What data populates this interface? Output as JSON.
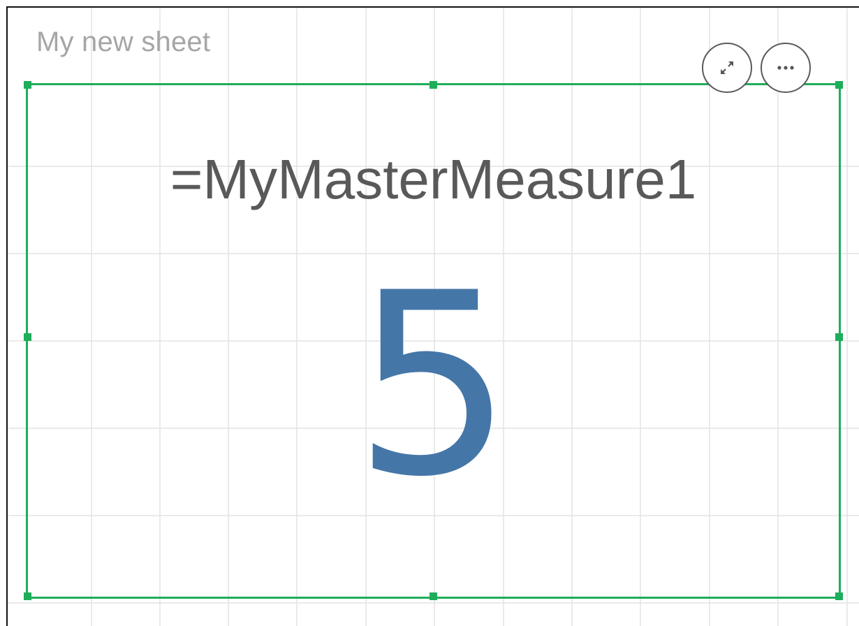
{
  "sheet": {
    "title": "My new sheet"
  },
  "kpi": {
    "label": "=MyMasterMeasure1",
    "value": "5"
  },
  "toolbar": {
    "expand_icon": "expand-icon",
    "more_icon": "more-options-icon"
  },
  "colors": {
    "selection_border": "#1ead5a",
    "kpi_value": "#4576a8",
    "kpi_label": "#595959",
    "sheet_title": "#a6a6a6"
  }
}
